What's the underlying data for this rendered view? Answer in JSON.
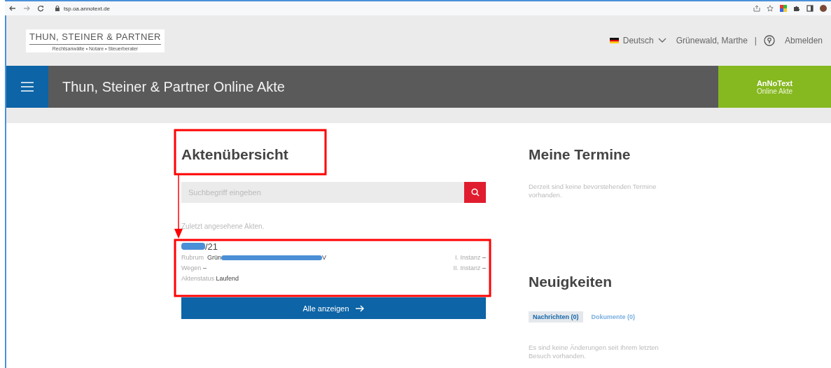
{
  "browser": {
    "url": "tsp.oa.annotext.de"
  },
  "logo": {
    "name": "THUN, STEINER & PARTNER",
    "tagline": "Rechtsanwälte • Notare • Steuerberater"
  },
  "header": {
    "language": "Deutsch",
    "user": "Grünewald, Marthe",
    "separator": "|",
    "logout": "Abmelden"
  },
  "app_bar": {
    "title": "Thun, Steiner & Partner Online Akte",
    "brand": "AnNoText",
    "brand_sub": "Online Akte"
  },
  "files": {
    "title": "Aktenübersicht",
    "search": {
      "placeholder": "Suchbegriff eingeben"
    },
    "recent_label": "Zuletzt angesehene Akten.",
    "recent": [
      {
        "number": "/21",
        "rubrum_label": "Rubrum",
        "rubrum_start": "Grün",
        "rubrum_end": "V",
        "wegen_label": "Wegen",
        "wegen": "–",
        "status_label": "Aktenstatus",
        "status": "Laufend",
        "instanz1_label": "I. Instanz",
        "instanz1": "–",
        "instanz2_label": "II. Instanz",
        "instanz2": "–"
      }
    ],
    "show_all": "Alle anzeigen"
  },
  "appointments": {
    "title": "Meine Termine",
    "empty": "Derzeit sind keine bevorstehenden Termine vorhanden."
  },
  "news": {
    "title": "Neuigkeiten",
    "tabs": [
      {
        "label": "Nachrichten (0)",
        "selected": true
      },
      {
        "label": "Dokumente (0)",
        "selected": false
      }
    ],
    "empty": "Es sind keine Änderungen seit Ihrem letzten Besuch vorhanden."
  }
}
